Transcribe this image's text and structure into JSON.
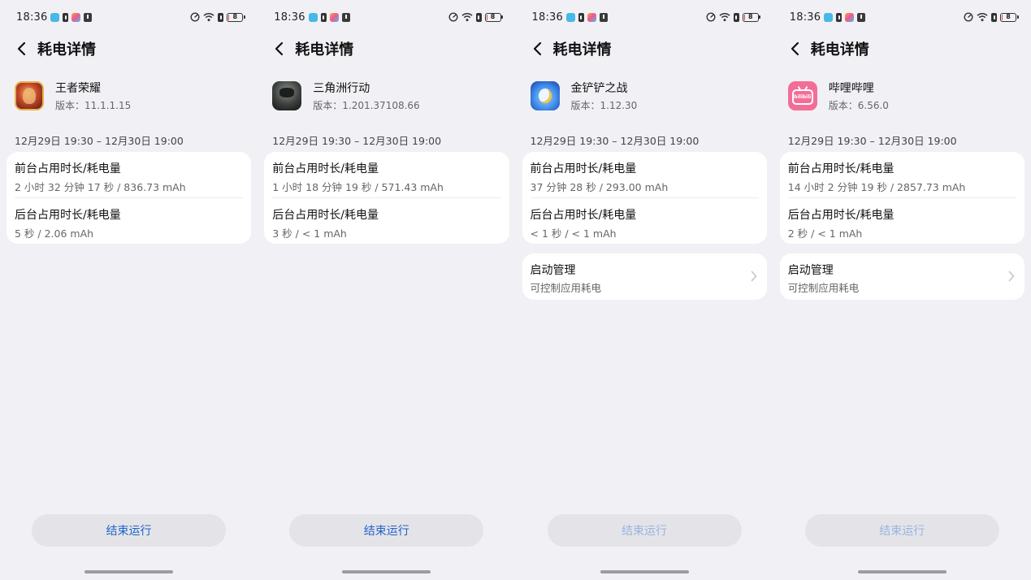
{
  "common": {
    "page_title": "耗电详情",
    "fg_title": "前台占用时长/耗电量",
    "bg_title": "后台占用时长/耗电量",
    "start_title": "启动管理",
    "start_sub": "可控制应用耗电",
    "end_button": "结束运行",
    "colors": {
      "background": "#f1f1f5",
      "card": "#ffffff",
      "accent_blue": "#1f62c9",
      "accent_blue_disabled": "#98b4e0",
      "button_bg": "#e4e4e8"
    }
  },
  "screens": [
    {
      "time": "18:36",
      "battery_level": "8",
      "app_name": "王者荣耀",
      "app_version": "版本：11.1.1.15",
      "app_icon": "wzry-app-icon",
      "range": "12月29日 19:30 – 12月30日 19:00",
      "fg_value": "2 小时 32 分钟 17 秒 / 836.73 mAh",
      "bg_value": "5 秒 / 2.06 mAh",
      "show_start_management": false,
      "end_button_enabled": true
    },
    {
      "time": "18:36",
      "battery_level": "8",
      "app_name": "三角洲行动",
      "app_version": "版本：1.201.37108.66",
      "app_icon": "sjz-app-icon",
      "range": "12月29日 19:30 – 12月30日 19:00",
      "fg_value": "1 小时 18 分钟 19 秒 / 571.43 mAh",
      "bg_value": "3 秒 / < 1 mAh",
      "show_start_management": false,
      "end_button_enabled": true
    },
    {
      "time": "18:36",
      "battery_level": "8",
      "app_name": "金铲铲之战",
      "app_version": "版本：1.12.30",
      "app_icon": "jcc-app-icon",
      "range": "12月29日 19:30 – 12月30日 19:00",
      "fg_value": "37 分钟 28 秒 / 293.00 mAh",
      "bg_value": "< 1 秒 / < 1 mAh",
      "show_start_management": true,
      "end_button_enabled": false
    },
    {
      "time": "18:36",
      "battery_level": "8",
      "app_name": "哔哩哔哩",
      "app_version": "版本：6.56.0",
      "app_icon": "bilibili-app-icon",
      "range": "12月29日 19:30 – 12月30日 19:00",
      "fg_value": "14 小时 2 分钟 19 秒 / 2857.73 mAh",
      "bg_value": "2 秒 / < 1 mAh",
      "show_start_management": true,
      "end_button_enabled": false
    }
  ]
}
